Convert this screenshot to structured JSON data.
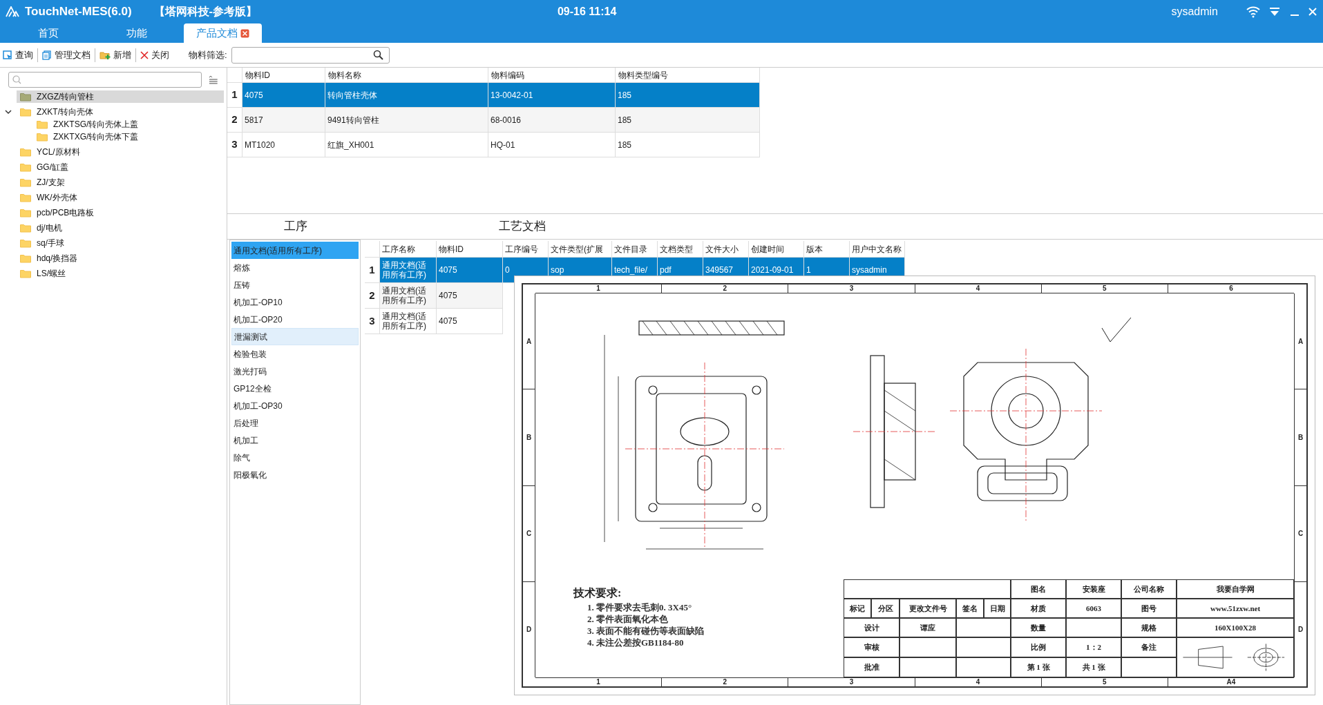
{
  "app": {
    "title": "TouchNet-MES(6.0)",
    "edition": "【塔网科技-参考版】",
    "clock": "09-16 11:14",
    "user": "sysadmin"
  },
  "tabs": [
    {
      "label": "首页",
      "selected": false,
      "closable": false
    },
    {
      "label": "功能",
      "selected": false,
      "closable": false
    },
    {
      "label": "产品文档",
      "selected": true,
      "closable": true
    }
  ],
  "toolbar": {
    "buttons": [
      {
        "label": "查询",
        "kind": "query"
      },
      {
        "label": "管理文档",
        "kind": "docs"
      },
      {
        "label": "新增",
        "kind": "add"
      },
      {
        "label": "关闭",
        "kind": "close"
      }
    ],
    "filter": {
      "label": "物料筛选:"
    }
  },
  "tree": [
    {
      "label": "ZXGZ/转向管柱",
      "selected": true
    },
    {
      "label": "ZXKT/转向壳体",
      "selected": false,
      "expanded": true,
      "children": [
        {
          "label": "ZXKTSG/转向壳体上盖",
          "selected": false
        },
        {
          "label": "ZXKTXG/转向壳体下盖",
          "selected": false
        }
      ]
    },
    {
      "label": "YCL/原材料",
      "selected": false
    },
    {
      "label": "GG/缸盖",
      "selected": false
    },
    {
      "label": "ZJ/支架",
      "selected": false
    },
    {
      "label": "WK/外壳体",
      "selected": false
    },
    {
      "label": "pcb/PCB电路板",
      "selected": false
    },
    {
      "label": "dj/电机",
      "selected": false
    },
    {
      "label": "sq/手球",
      "selected": false
    },
    {
      "label": "hdq/换挡器",
      "selected": false
    },
    {
      "label": "LS/螺丝",
      "selected": false
    }
  ],
  "materials": {
    "columns": [
      "物料ID",
      "物料名称",
      "物料编码",
      "物料类型编号"
    ],
    "rows": [
      {
        "number": "1",
        "selected": true,
        "cells": [
          "4075",
          "转向管柱壳体",
          "13-0042-01",
          "185"
        ]
      },
      {
        "number": "2",
        "selected": false,
        "cells": [
          "5817",
          "9491转向管柱",
          "68-0016",
          "185"
        ]
      },
      {
        "number": "3",
        "selected": false,
        "cells": [
          "MT1020",
          "红旗_XH001",
          "HQ-01",
          "185"
        ]
      }
    ]
  },
  "process_title": "工序",
  "docs_title": "工艺文档",
  "processes": [
    {
      "label": "通用文档(适用所有工序)",
      "selected": true,
      "highlighted": false
    },
    {
      "label": "熔炼",
      "selected": false,
      "highlighted": false
    },
    {
      "label": "压铸",
      "selected": false,
      "highlighted": false
    },
    {
      "label": "机加工-OP10",
      "selected": false,
      "highlighted": false
    },
    {
      "label": "机加工-OP20",
      "selected": false,
      "highlighted": false
    },
    {
      "label": "泄漏测试",
      "selected": false,
      "highlighted": true
    },
    {
      "label": "检验包装",
      "selected": false,
      "highlighted": false
    },
    {
      "label": "激光打码",
      "selected": false,
      "highlighted": false
    },
    {
      "label": "GP12全检",
      "selected": false,
      "highlighted": false
    },
    {
      "label": "机加工-OP30",
      "selected": false,
      "highlighted": false
    },
    {
      "label": "后处理",
      "selected": false,
      "highlighted": false
    },
    {
      "label": "机加工",
      "selected": false,
      "highlighted": false
    },
    {
      "label": "除气",
      "selected": false,
      "highlighted": false
    },
    {
      "label": "阳极氧化",
      "selected": false,
      "highlighted": false
    }
  ],
  "documents": {
    "columns": [
      "工序名称",
      "物料ID",
      "工序编号",
      "文件类型(扩展",
      "文件目录",
      "文档类型",
      "文件大小",
      "创建时间",
      "版本",
      "用户中文名称"
    ],
    "rows": [
      {
        "number": "1",
        "selected": true,
        "cells": [
          "通用文档(适用所有工序)",
          "4075",
          "0",
          "sop",
          "tech_file/",
          "pdf",
          "349567",
          "2021-09-01",
          "1",
          "sysadmin"
        ]
      },
      {
        "number": "2",
        "selected": false,
        "cells": [
          "通用文档(适用所有工序)",
          "4075"
        ]
      },
      {
        "number": "3",
        "selected": false,
        "cells": [
          "通用文档(适用所有工序)",
          "4075"
        ]
      }
    ]
  },
  "preview": {
    "top_labels": [
      "1",
      "2",
      "3",
      "4",
      "5",
      "6"
    ],
    "bottom_labels": [
      "1",
      "2",
      "3",
      "4",
      "5",
      "A4"
    ],
    "left_labels": [
      "A",
      "B",
      "C",
      "D"
    ],
    "right_labels": [
      "A",
      "B",
      "C",
      "D"
    ],
    "requirements": {
      "title": "技术要求:",
      "lines": [
        "1. 零件要求去毛刺0. 3X45°",
        "2. 零件表面氧化本色",
        "3. 表面不能有碰伤等表面缺陷",
        "4. 未注公差按GB1184-80"
      ]
    },
    "revision_headers": [
      "标记",
      "分区",
      "更改文件号",
      "签名",
      "日期"
    ],
    "signoff": [
      {
        "role": "设计",
        "name": "谭应"
      },
      {
        "role": "审核"
      },
      {
        "role": "批准"
      }
    ],
    "info_rows": [
      {
        "c1": "图名",
        "c2": "安装座",
        "c3": "公司名称",
        "c4": "我要自学网"
      },
      {
        "c1": "材质",
        "c2": "6063",
        "c3": "图号",
        "c4": "www.51zxw.net"
      },
      {
        "c1": "数量",
        "c3": "规格",
        "c4": "160X100X28"
      },
      {
        "c1": "比例",
        "c2": "1：2",
        "c3": "备注"
      },
      {
        "c1": "第 1 张",
        "c2": "共 1 张"
      }
    ]
  }
}
